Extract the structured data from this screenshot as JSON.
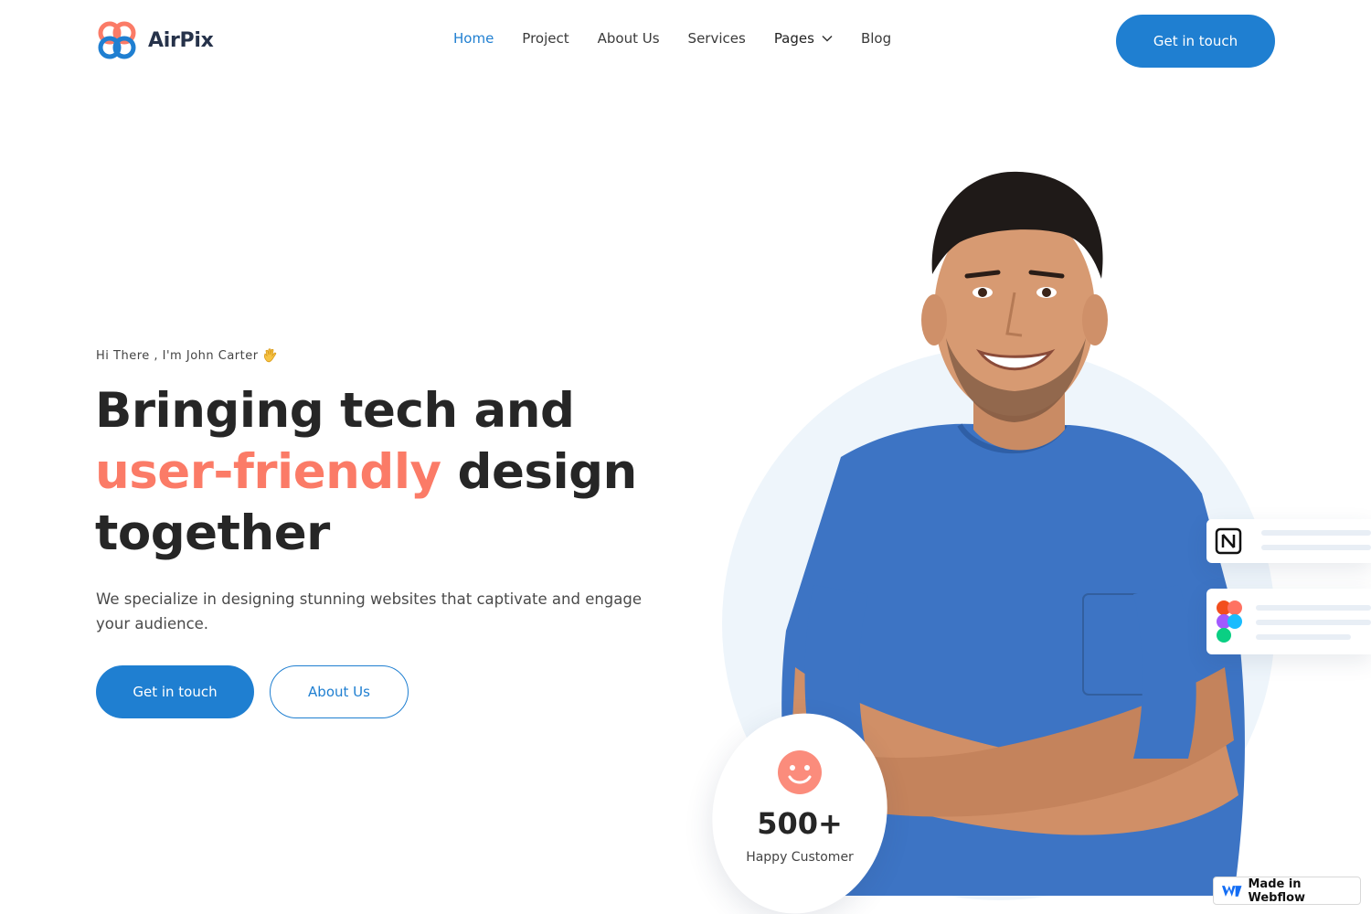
{
  "brand": {
    "name": "AirPix"
  },
  "nav": {
    "items": [
      {
        "label": "Home",
        "active": true
      },
      {
        "label": "Project"
      },
      {
        "label": "About Us"
      },
      {
        "label": "Services"
      },
      {
        "label": "Pages",
        "has_dropdown": true
      },
      {
        "label": "Blog"
      }
    ],
    "cta_label": "Get in touch"
  },
  "hero": {
    "greeting": "Hi There , I'm John Carter",
    "greeting_icon": "waving-hand-icon",
    "title_line1": "Bringing tech and",
    "title_accent": "user-friendly",
    "title_line2_rest": " design",
    "title_line3": "together",
    "description": "We specialize in designing stunning websites that captivate and engage your audience.",
    "primary_button": "Get in touch",
    "secondary_button": "About Us"
  },
  "stats": {
    "icon": "smiley-icon",
    "value": "500+",
    "label": "Happy Customer"
  },
  "tools": [
    {
      "icon": "notion-icon"
    },
    {
      "icon": "figma-icon"
    }
  ],
  "badge": {
    "label": "Made in Webflow",
    "icon": "webflow-icon"
  },
  "colors": {
    "primary": "#1f7fd1",
    "accent": "#fb7b67",
    "heading": "#262626",
    "circle_bg": "#eef5fb",
    "shirt": "#3d74c4"
  }
}
